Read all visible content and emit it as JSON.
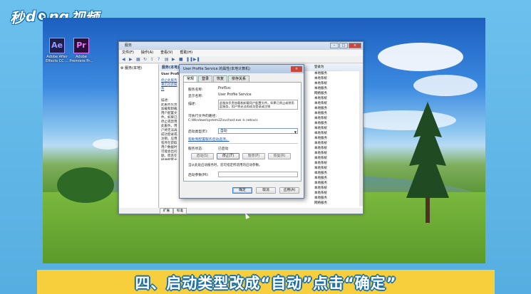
{
  "brand": {
    "part1": "秒",
    "part2": "d",
    "part3": "ng",
    "part4": "视频"
  },
  "desktop_icons": [
    {
      "glyph": "Ae",
      "caption": "Adobe After Effects CC ...",
      "color": "#9999ff",
      "bg": "#1e1e4a"
    },
    {
      "glyph": "Pr",
      "caption": "Adobe Premiere Pr...",
      "color": "#ea77ff",
      "bg": "#2a0f36"
    }
  ],
  "services_window": {
    "title": "服务",
    "menu": [
      "文件(F)",
      "操作(A)",
      "查看(V)",
      "帮助(H)"
    ],
    "tree_item": "服务(本地)",
    "panel_header": "服务(本地)",
    "selected_service": "User Profi",
    "links": [
      "停止此服务",
      "重启动此服务"
    ],
    "desc_label": "描述:",
    "desc_text": "此服务负责加载和卸载用户配置文件。如果已停止或禁用此服务，用户将无法再成功登录或注销，应用程序在获取用户数据时可能会出问题，而且在接收配置文件事件通知后注册的组件也将无法接收通知。",
    "login_col_header": "登录为",
    "login_values": [
      "本地服务",
      "本地系统",
      "本地系统",
      "本地服务",
      "网络服务",
      "本地系统",
      "本地系统",
      "本地服务",
      "本地服务",
      "本地系统",
      "本地服务",
      "本地系统",
      "本地系统",
      "本地服务",
      "本地系统",
      "本地系统",
      "本地系统",
      "本地系统",
      "本地系统",
      "本地系统",
      "本地服务",
      "本地服务",
      "本地服务",
      "本地系统",
      "本地系统",
      "本地服务",
      "网络服务"
    ],
    "bottom_rows": [
      {
        "name": "Windows Driver ...",
        "status": "创建...",
        "startup": "手动"
      },
      {
        "name": "Windows Error ...",
        "status": "允许...",
        "startup": "手动"
      }
    ],
    "tabs": [
      "扩展",
      "标准"
    ]
  },
  "dialog": {
    "title": "User Profile Service 的属性(本地计算机)",
    "close": "×",
    "tabs": [
      "常规",
      "登录",
      "恢复",
      "依存关系"
    ],
    "service_name_label": "服务名称:",
    "service_name": "ProfSvc",
    "display_name_label": "显示名称:",
    "display_name": "User Profile Service",
    "description_label": "描述:",
    "description": "此服务负责加载和卸载用户配置文件。如果已停止或禁用此服务，用户将无法再成功登录或注销",
    "path_label": "可执行文件的路径:",
    "path": "C:\\Windows\\system32\\svchost.exe -k netsvcs",
    "startup_label": "启动类型(E):",
    "startup_value": "自动",
    "help_link": "帮助我配置服务启动选项。",
    "status_label": "服务状态:",
    "status_value": "已启动",
    "buttons": [
      "启动(S)",
      "停止(T)",
      "暂停(P)",
      "恢复(R)"
    ],
    "hint": "当从此处启动服务时，您可指定所适用的启动参数。",
    "params_label": "启动参数(M):",
    "footer": [
      "确定",
      "取消",
      "应用(A)"
    ]
  },
  "caption": "四、启动类型改成“自动”点击“确定”"
}
